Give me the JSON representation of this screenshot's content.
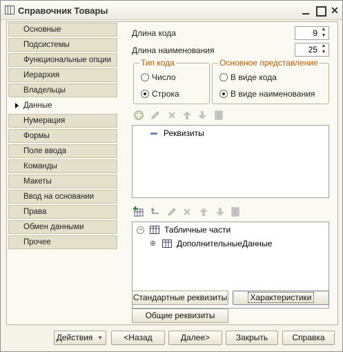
{
  "window": {
    "title": "Справочник Товары",
    "minimize": "minimize",
    "maximize": "maximize",
    "close": "✕"
  },
  "tabs": [
    {
      "label": "Основные"
    },
    {
      "label": "Подсистемы"
    },
    {
      "label": "Функциональные опции"
    },
    {
      "label": "Иерархия"
    },
    {
      "label": "Владельцы"
    },
    {
      "label": "Данные",
      "active": true
    },
    {
      "label": "Нумерация"
    },
    {
      "label": "Формы"
    },
    {
      "label": "Поле ввода"
    },
    {
      "label": "Команды"
    },
    {
      "label": "Макеты"
    },
    {
      "label": "Ввод на основании"
    },
    {
      "label": "Права"
    },
    {
      "label": "Обмен данными"
    },
    {
      "label": "Прочее"
    }
  ],
  "data_tab": {
    "code_length_label": "Длина кода",
    "code_length_value": "9",
    "name_length_label": "Длина наименования",
    "name_length_value": "25",
    "code_type": {
      "title": "Тип кода",
      "options": [
        "Число",
        "Строка"
      ],
      "selected": "Строка"
    },
    "main_presentation": {
      "title": "Основное представление",
      "options": [
        "В виде кода",
        "В виде наименования"
      ],
      "selected": "В виде наименования"
    },
    "attributes_tree": {
      "root": "Реквизиты"
    },
    "tabular_tree": {
      "root": "Табличные части",
      "child": "ДополнительныеДанные"
    },
    "buttons": {
      "standard_attributes": "Стандартные реквизиты",
      "characteristics": "Характеристики",
      "common_attributes": "Общие реквизиты"
    }
  },
  "footer": {
    "actions": "Действия",
    "back": "<Назад",
    "next": "Далее>",
    "close": "Закрыть",
    "help": "Справка"
  },
  "colors": {
    "group_title": "#b85a00",
    "tab_bg": "#e3e0cb",
    "panel_bg": "#fbfaf2"
  }
}
